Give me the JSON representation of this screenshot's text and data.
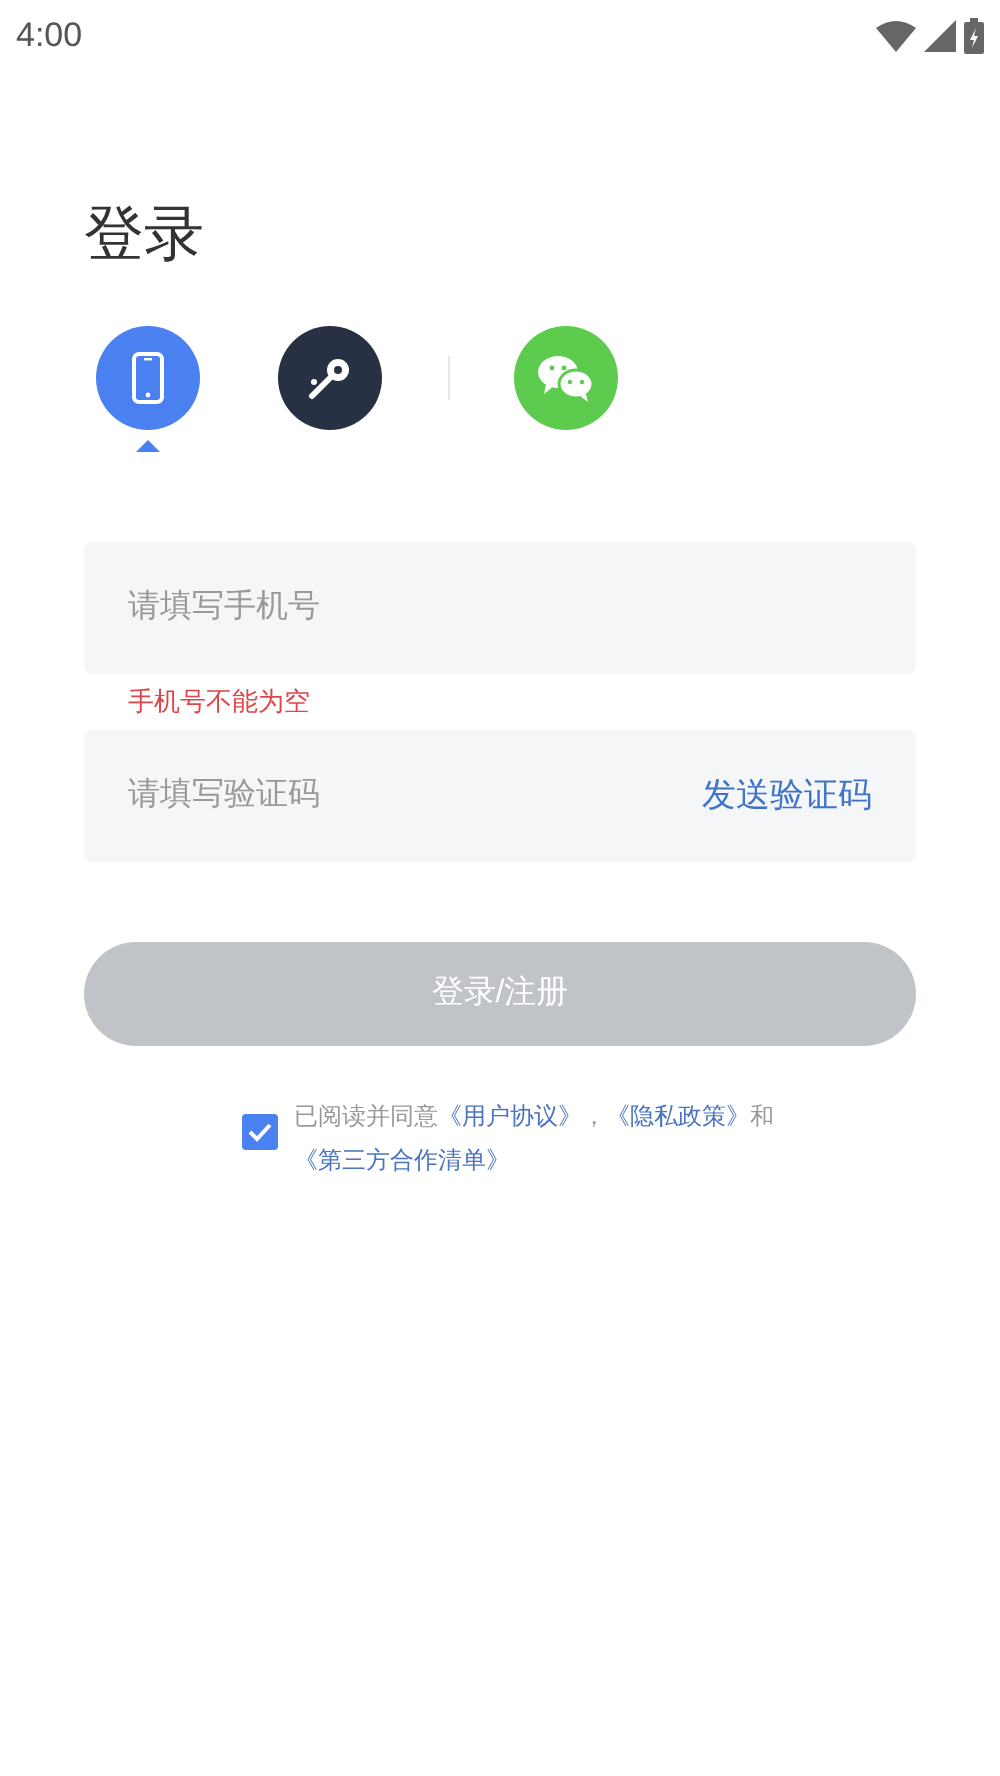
{
  "status_bar": {
    "time": "4:00"
  },
  "title": "登录",
  "login_methods": [
    {
      "kind": "phone",
      "selected": true
    },
    {
      "kind": "password",
      "selected": false
    },
    {
      "kind": "wechat",
      "selected": false
    }
  ],
  "phone_field": {
    "placeholder": "请填写手机号"
  },
  "phone_error": "手机号不能为空",
  "code_field": {
    "placeholder": "请填写验证码",
    "send_button": "发送验证码"
  },
  "submit_button": {
    "label": "登录/注册",
    "disabled": true
  },
  "agreement": {
    "checked": true,
    "parts": [
      {
        "kind": "text",
        "text": "已阅读并同意"
      },
      {
        "kind": "link",
        "text": "《用户协议》"
      },
      {
        "kind": "text",
        "text": "，"
      },
      {
        "kind": "link",
        "text": "《隐私政策》"
      },
      {
        "kind": "text",
        "text": "和"
      },
      {
        "kind": "link",
        "text": "《第三方合作清单》"
      }
    ]
  }
}
